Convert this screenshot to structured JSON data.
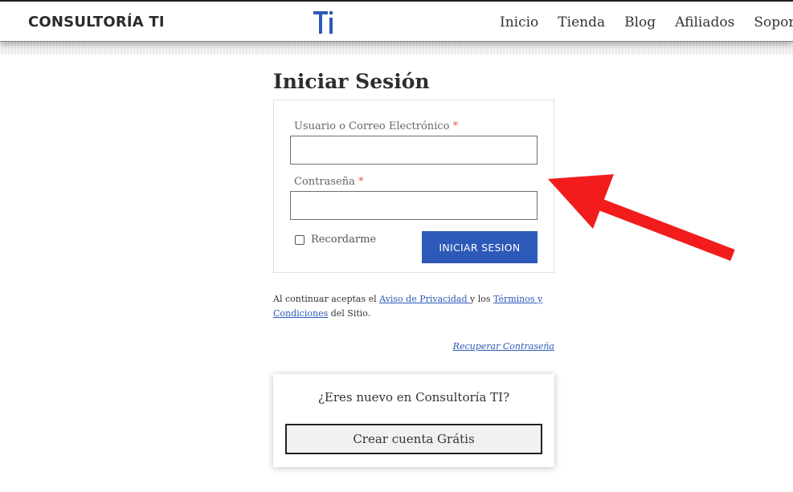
{
  "header": {
    "brand": "CONSULTORÍA TI",
    "logo_text": "Ti",
    "nav": [
      "Inicio",
      "Tienda",
      "Blog",
      "Afiliados",
      "Soporte"
    ]
  },
  "login": {
    "title": "Iniciar Sesión",
    "username_label": "Usuario o Correo Electrónico",
    "password_label": "Contraseña",
    "required_mark": "*",
    "username_value": "",
    "password_value": "",
    "remember_label": "Recordarme",
    "remember_checked": false,
    "submit_label": "INICIAR SESION"
  },
  "terms": {
    "prefix": "Al continuar aceptas el ",
    "privacy_link": "Aviso de Privacidad ",
    "middle": "y los ",
    "terms_link": "Términos y Condiciones",
    "suffix": " del Sitio."
  },
  "recover_link": "Recuperar Contraseña",
  "signup": {
    "question": "¿Eres nuevo en Consultoría TI?",
    "button_label": "Crear cuenta Grátis"
  },
  "colors": {
    "accent": "#2d59b8",
    "arrow": "#f21c1c"
  }
}
